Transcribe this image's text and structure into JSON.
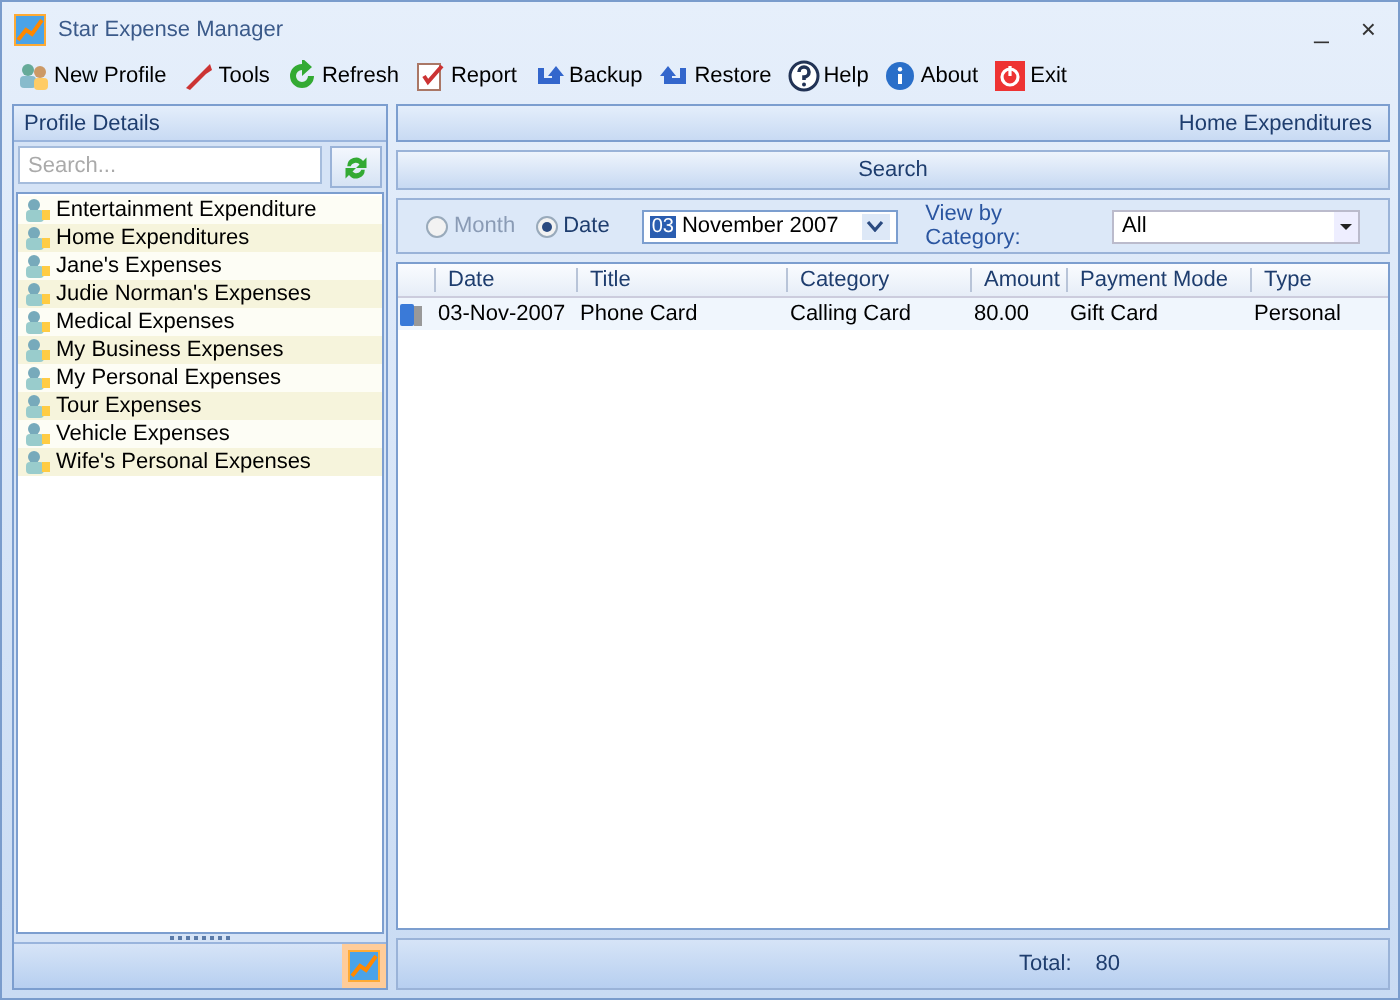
{
  "window": {
    "title": "Star Expense Manager",
    "controls": [
      "_",
      "×"
    ]
  },
  "toolbar": [
    {
      "label": "New Profile",
      "kind": "new"
    },
    {
      "label": "Tools",
      "kind": "tools"
    },
    {
      "label": "Refresh",
      "kind": "refresh"
    },
    {
      "label": "Report",
      "kind": "report"
    },
    {
      "label": "Backup",
      "kind": "backup"
    },
    {
      "label": "Restore",
      "kind": "restore"
    },
    {
      "label": "Help",
      "kind": "help"
    },
    {
      "label": "About",
      "kind": "about"
    },
    {
      "label": "Exit",
      "kind": "exit"
    }
  ],
  "sidebar": {
    "title": "Profile Details",
    "search": {
      "placeholder": "Search..."
    },
    "items": [
      {
        "label": "Entertainment Expenditure"
      },
      {
        "label": "Home Expenditures"
      },
      {
        "label": "Jane's Expenses"
      },
      {
        "label": "Judie Norman's Expenses"
      },
      {
        "label": "Medical Expenses"
      },
      {
        "label": "My Business Expenses"
      },
      {
        "label": "My Personal Expenses"
      },
      {
        "label": "Tour Expenses"
      },
      {
        "label": "Vehicle Expenses"
      },
      {
        "label": "Wife's Personal Expenses"
      }
    ]
  },
  "main": {
    "profile_title": "Home Expenditures",
    "search_title": "Search",
    "filter": {
      "modes": [
        {
          "label": "Month",
          "selected": false,
          "disabled": true
        },
        {
          "label": "Date",
          "selected": true,
          "disabled": false
        }
      ],
      "date": {
        "day": "03",
        "value": "November  2007"
      },
      "category_label": "View by Category:",
      "category": "All"
    },
    "table": {
      "columns": [
        "Date",
        "Title",
        "Category",
        "Amount",
        "Payment Mode",
        "Type"
      ],
      "rows": [
        {
          "cells": [
            "03-Nov-2007",
            "Phone Card",
            "Calling Card",
            "80.00",
            "Gift Card",
            "Personal"
          ]
        }
      ]
    },
    "total_label": "Total:",
    "total": "80"
  }
}
